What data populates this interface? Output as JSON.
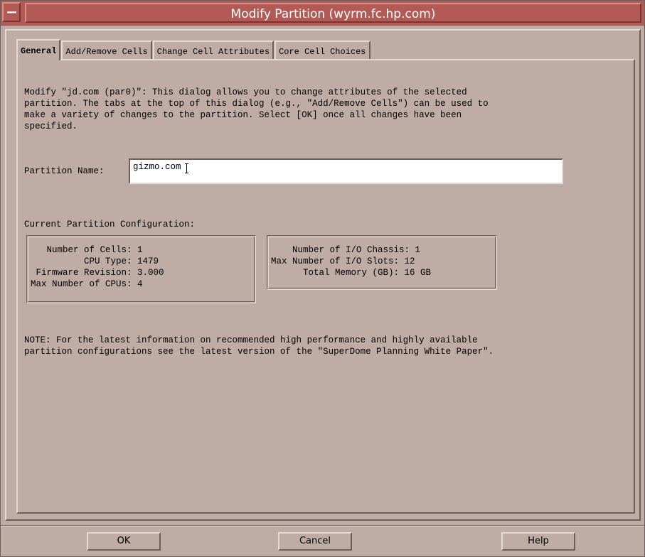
{
  "window": {
    "title": "Modify Partition (wyrm.fc.hp.com)"
  },
  "tabs": [
    {
      "label": "General",
      "active": true
    },
    {
      "label": "Add/Remove Cells",
      "active": false
    },
    {
      "label": "Change Cell Attributes",
      "active": false
    },
    {
      "label": "Core Cell Choices",
      "active": false
    }
  ],
  "general": {
    "description": "Modify \"jd.com (par0)\": This dialog allows you to change attributes of the selected\npartition. The tabs at the top of this dialog (e.g., \"Add/Remove Cells\") can be used to\nmake a variety of changes to the partition. Select [OK] once all changes have been\nspecified.",
    "partition_name_label": "Partition Name:",
    "partition_name_value": "gizmo.com",
    "config_label": "Current Partition Configuration:",
    "config_left": [
      "   Number of Cells: 1",
      "          CPU Type: 1479",
      " Firmware Revision: 3.000",
      "Max Number of CPUs: 4"
    ],
    "config_right": [
      "    Number of I/O Chassis: 1",
      "Max Number of I/O Slots: 12",
      "      Total Memory (GB): 16 GB"
    ],
    "note": "NOTE: For the latest information on recommended high performance and highly available\npartition configurations see the latest version of the \"SuperDome Planning White Paper\"."
  },
  "buttons": {
    "ok": "OK",
    "cancel": "Cancel",
    "help": "Help"
  },
  "colors": {
    "background": "#bfaca5",
    "titlebar": "#b45a55",
    "title_text": "#ffffff"
  },
  "icons": {
    "window_menu": "window-menu-icon",
    "text_cursor": "ibeam-cursor-icon"
  }
}
